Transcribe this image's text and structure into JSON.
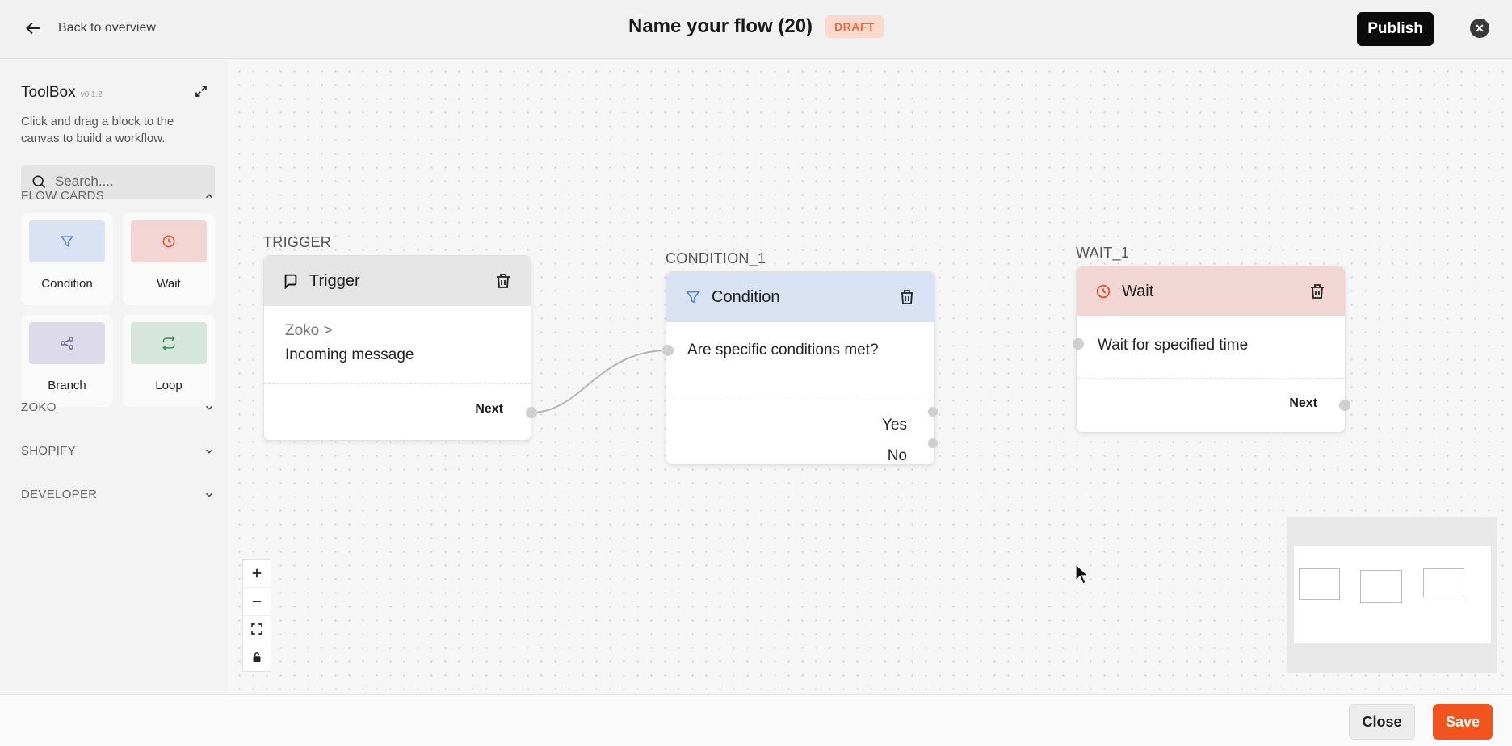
{
  "header": {
    "back_label": "Back to overview",
    "title": "Name your flow (20)",
    "badge": "DRAFT",
    "publish_label": "Publish"
  },
  "toolbox": {
    "title": "ToolBox",
    "version": "v0.1.2",
    "description": "Click and drag a block to the canvas to build a workflow.",
    "search_placeholder": "Search....",
    "sections": {
      "flow_cards": "FLOW CARDS",
      "zoko": "ZOKO",
      "shopify": "SHOPIFY",
      "developer": "DEVELOPER"
    },
    "cards": [
      {
        "label": "Condition",
        "color": "#d9e3f3",
        "icon": "filter-icon"
      },
      {
        "label": "Wait",
        "color": "#f3d6d3",
        "icon": "clock-icon"
      },
      {
        "label": "Branch",
        "color": "#dddbe9",
        "icon": "branch-icon"
      },
      {
        "label": "Loop",
        "color": "#d6e6dc",
        "icon": "loop-icon"
      }
    ]
  },
  "nodes": {
    "trigger": {
      "id_label": "TRIGGER",
      "title": "Trigger",
      "source": "Zoko >",
      "event": "Incoming message",
      "next_label": "Next",
      "header_color": "#e5e5e5"
    },
    "condition": {
      "id_label": "CONDITION_1",
      "title": "Condition",
      "question": "Are specific conditions met?",
      "yes_label": "Yes",
      "no_label": "No",
      "header_color": "#d8e2f3"
    },
    "wait": {
      "id_label": "WAIT_1",
      "title": "Wait",
      "description": "Wait for specified time",
      "next_label": "Next",
      "header_color": "#f2d6d3"
    }
  },
  "footer": {
    "close_label": "Close",
    "save_label": "Save"
  }
}
